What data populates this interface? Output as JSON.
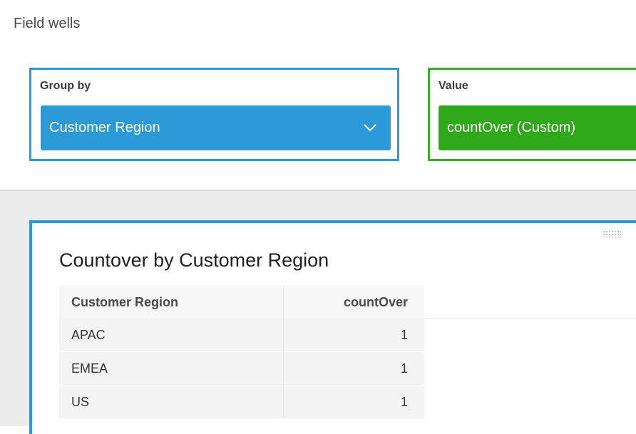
{
  "field_wells": {
    "title": "Field wells",
    "group_by": {
      "label": "Group by",
      "field": "Customer Region",
      "icon": "chevron-down-icon",
      "color": "#2b9ad6"
    },
    "value": {
      "label": "Value",
      "field": "countOver (Custom)",
      "color": "#2fa81a"
    }
  },
  "visual": {
    "title": "Countover by Customer Region",
    "accent": "#2b9ad6",
    "table": {
      "headers": [
        "Customer Region",
        "countOver"
      ],
      "rows": [
        [
          "APAC",
          "1"
        ],
        [
          "EMEA",
          "1"
        ],
        [
          "US",
          "1"
        ]
      ]
    }
  }
}
